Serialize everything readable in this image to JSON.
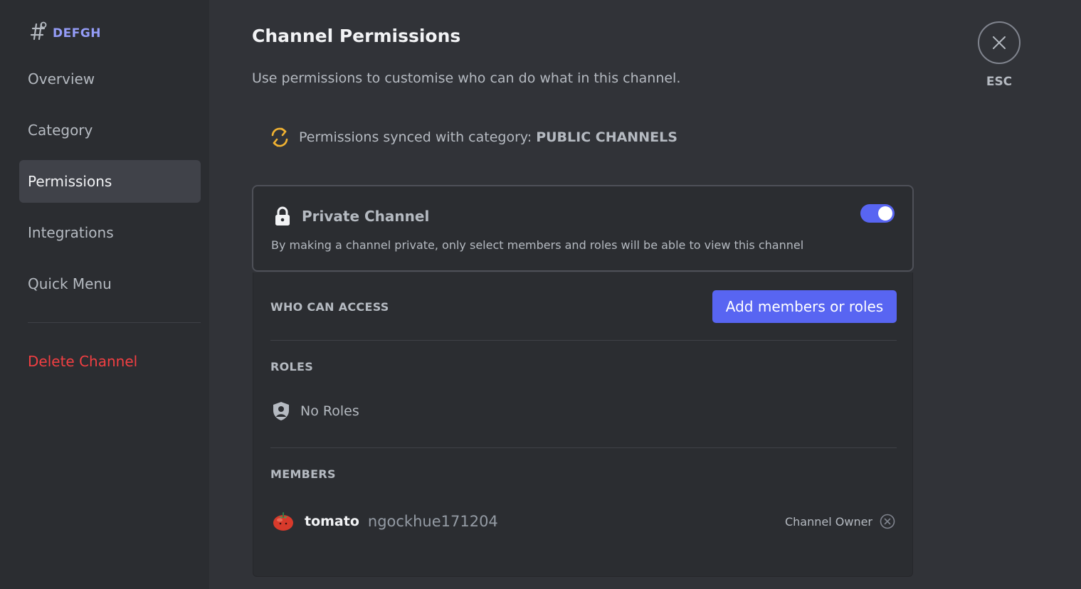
{
  "sidebar": {
    "channel_name": "DEFGH",
    "items": [
      {
        "label": "Overview"
      },
      {
        "label": "Category"
      },
      {
        "label": "Permissions"
      },
      {
        "label": "Integrations"
      },
      {
        "label": "Quick Menu"
      }
    ],
    "delete_label": "Delete Channel"
  },
  "main": {
    "title": "Channel Permissions",
    "subtitle": "Use permissions to customise who can do what in this channel.",
    "sync_text": "Permissions synced with category:",
    "sync_category": "PUBLIC CHANNELS",
    "esc_label": "ESC",
    "private": {
      "title": "Private Channel",
      "description": "By making a channel private, only select members and roles will be able to view this channel",
      "enabled": true
    },
    "access": {
      "header": "WHO CAN ACCESS",
      "add_button": "Add members or roles",
      "roles_header": "ROLES",
      "no_roles": "No Roles",
      "members_header": "MEMBERS",
      "members": [
        {
          "display_name": "tomato",
          "username": "ngockhue171204",
          "role": "Channel Owner"
        }
      ]
    }
  },
  "colors": {
    "accent": "#5865f2",
    "danger": "#f23f42",
    "sync_icon": "#f0b232",
    "channel_name": "#949cf7"
  },
  "icons": {
    "channel": "hashtag-icon",
    "sync": "sync-icon",
    "close": "close-icon",
    "lock": "lock-icon",
    "roles": "shield-icon",
    "avatar": "tomato-avatar",
    "remove": "remove-icon"
  }
}
